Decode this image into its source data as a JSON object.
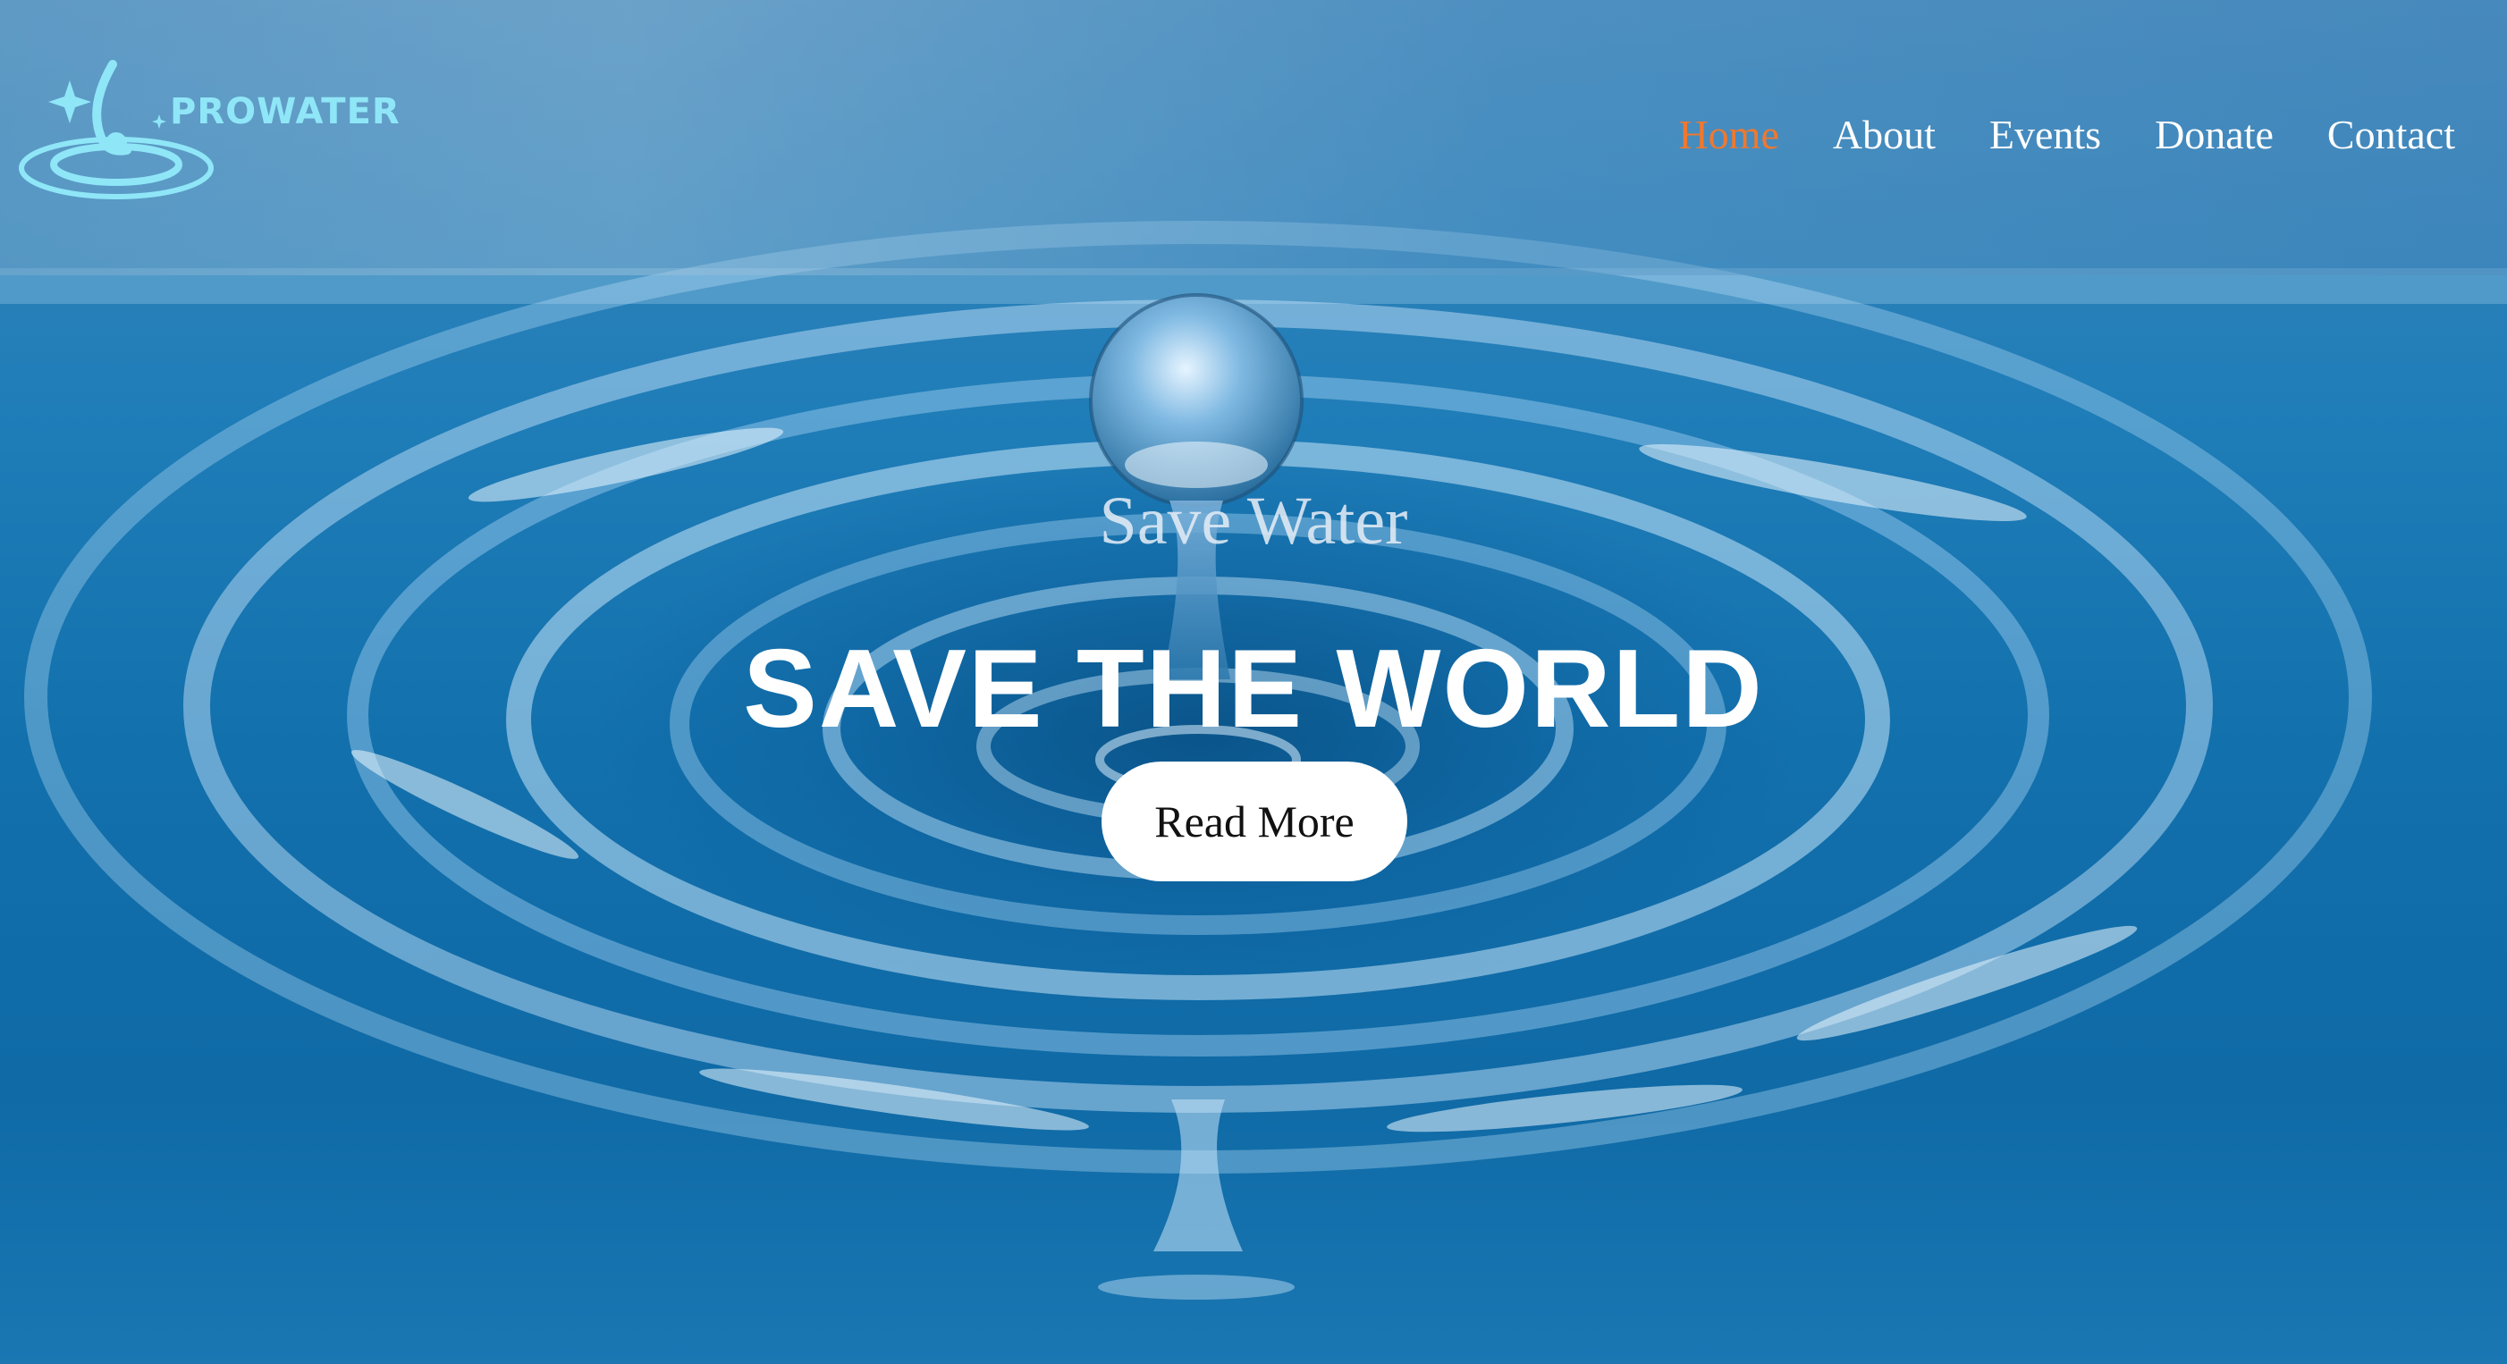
{
  "brand": {
    "name": "PROWATER",
    "logo_icon": "water-drop-ripple-icon",
    "logo_color": "#8fe6f7"
  },
  "nav": {
    "items": [
      {
        "label": "Home",
        "active": true
      },
      {
        "label": "About",
        "active": false
      },
      {
        "label": "Events",
        "active": false
      },
      {
        "label": "Donate",
        "active": false
      },
      {
        "label": "Contact",
        "active": false
      }
    ],
    "active_color": "#f0782e"
  },
  "hero": {
    "subtitle": "Save Water",
    "title": "SAVE THE WORLD",
    "cta_label": "Read More",
    "background": "water-drop-ripple-image"
  }
}
